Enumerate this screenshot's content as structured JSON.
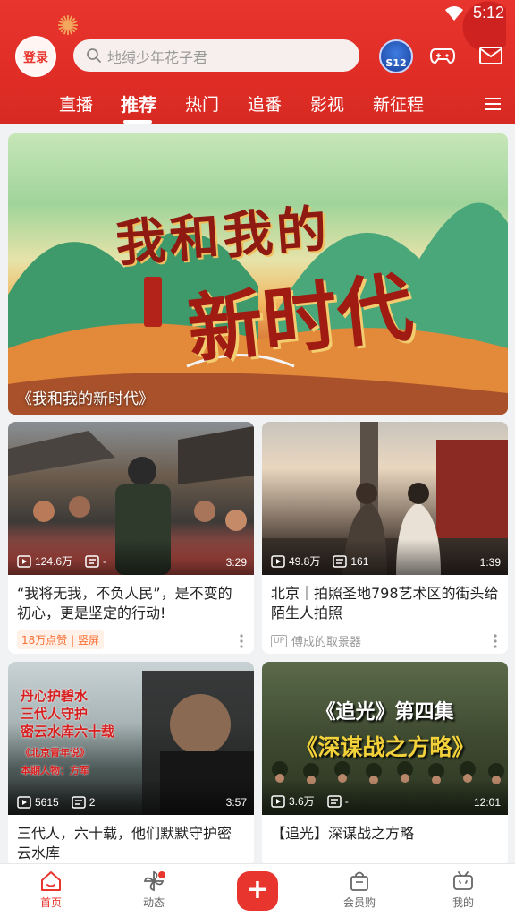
{
  "status": {
    "time": "5:12"
  },
  "header": {
    "login_label": "登录",
    "search_placeholder": "地缚少年花子君",
    "s12_label": "S12"
  },
  "tabs": [
    {
      "label": "直播"
    },
    {
      "label": "推荐",
      "active": true
    },
    {
      "label": "热门"
    },
    {
      "label": "追番"
    },
    {
      "label": "影视"
    },
    {
      "label": "新征程"
    }
  ],
  "banner": {
    "caption": "《我和我的新时代》",
    "art_line1": "我和我的",
    "art_line2": "新时代"
  },
  "cards": [
    {
      "views": "124.6万",
      "comments": "-",
      "duration": "3:29",
      "title": "“我将无我，不负人民”，是不变的初心，更是坚定的行动!",
      "tag": "18万点赞 | 竖屏"
    },
    {
      "views": "49.8万",
      "comments": "161",
      "duration": "1:39",
      "title": "北京｜拍照圣地798艺术区的街头给陌生人拍照",
      "up_badge": "UP",
      "uploader": "傅成的取景器"
    },
    {
      "views": "5615",
      "comments": "2",
      "duration": "3:57",
      "title": "三代人，六十载，他们默默守护密云水库",
      "thumb_text_1": "丹心护碧水",
      "thumb_text_2": "三代人守护",
      "thumb_text_3": "密云水库六十载",
      "thumb_text_4": "《北京青年说》",
      "thumb_text_5": "本期人物：方军"
    },
    {
      "views": "3.6万",
      "comments": "-",
      "duration": "12:01",
      "title": "【追光】深谋战之方略",
      "thumb_text_1": "《追光》第四集",
      "thumb_text_2": "《深谋战之方略》"
    }
  ],
  "bottom_nav": [
    {
      "label": "首页",
      "active": true
    },
    {
      "label": "动态"
    },
    {
      "label": "+"
    },
    {
      "label": "会员购"
    },
    {
      "label": "我的"
    }
  ],
  "colors": {
    "brand": "#e8352d",
    "tag_orange": "#fa6f32"
  }
}
